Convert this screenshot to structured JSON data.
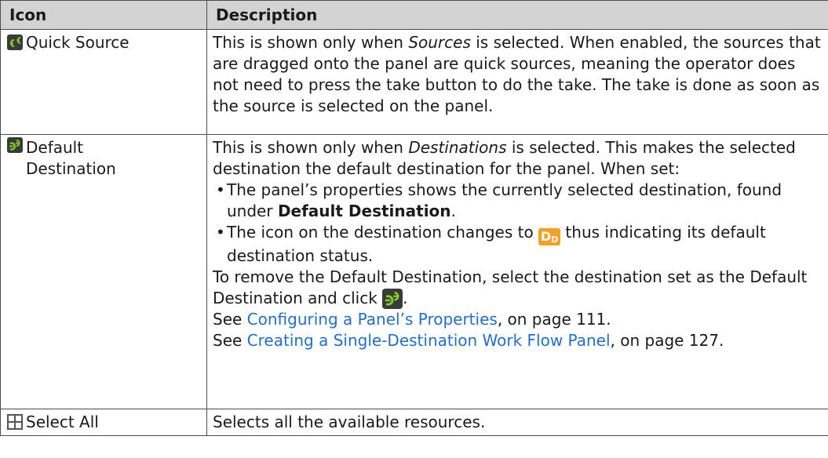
{
  "header": {
    "icon": "Icon",
    "description": "Description"
  },
  "rows": {
    "quick": {
      "icon": "quick-source-icon",
      "label": "Quick Source",
      "d1": "This is shown only when ",
      "d1_em": "Sources",
      "d1_rest": " is selected. When enabled, the sources that are dragged onto the panel are quick sources, meaning the operator does not need to press the take button to do the take. The take is done as soon as the source is selected on the panel."
    },
    "default": {
      "icon": "default-destination-icon",
      "label": "Default Destination",
      "d1": "This is shown only when ",
      "d1_em": "Destinations",
      "d1_rest": " is selected. This makes the selected destination the default destination for the panel. When set:",
      "b1": "The panel’s properties shows the currently selected destination, found under ",
      "b1_bold": "Default Destination",
      "b1_end": ".",
      "b2": "The icon on the destination changes to ",
      "b2_badge": "D",
      "b2_badge_sub": "D",
      "b2_rest": " thus indicating its default destination status.",
      "remove": "To remove the Default Destination, select the destination set as the Default Destination and click ",
      "remove_end": ".",
      "see1_pre": "See ",
      "see1_link": "Configuring a Panel’s Properties",
      "see1_post": ", on page 111.",
      "see2_pre": "See ",
      "see2_link": "Creating a Single-Destination Work Flow Panel",
      "see2_post": ", on page 127."
    },
    "select": {
      "icon": "select-all-icon",
      "label": "Select All",
      "desc": "Selects all the available resources."
    }
  },
  "colors": {
    "header_bg": "#d3d3d3",
    "link": "#1f6fd0",
    "badge": "#f4a020"
  }
}
